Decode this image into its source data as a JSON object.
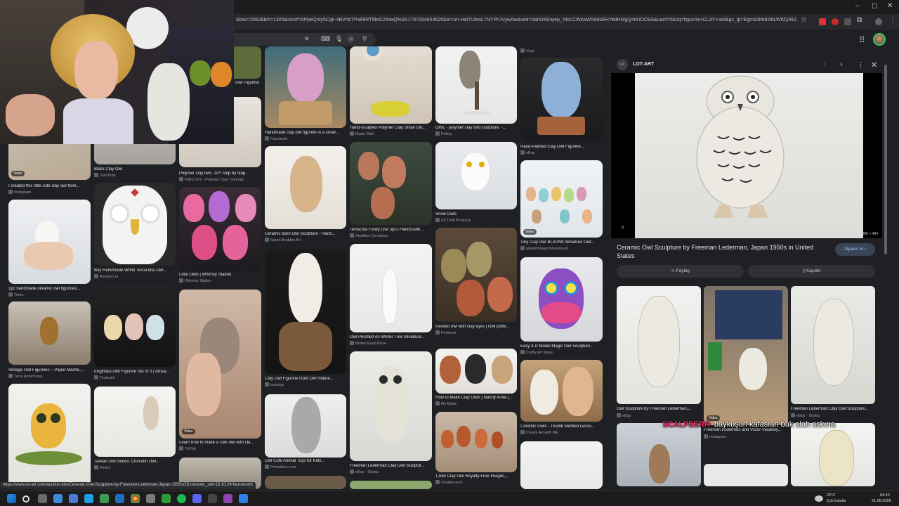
{
  "browser": {
    "url": "&biw=2560&bih=1305&ssrsf=APpeQnty5Cgk-4BVhbTPa69RTMeG294aQ%3A1787264954626&ei=un-Hat7UbmL7NYPh7vywAw&ved=0ahUKEwjep_XloLCWAxWS8dsEHYedHMgQ4dUDCBA&uact=5&oq=figurine+CLAY+owl&gs_lp=Egtnd3Mtd2l6LWltZyIRZ...",
    "window_controls": [
      "–",
      "◻",
      "✕"
    ]
  },
  "grid": {
    "col1": [
      {
        "caption": "I created this little cute clay owl from...",
        "source": "Instagram",
        "badge": "Video"
      },
      {
        "caption": "1pc handmade ceramic owl figurines...",
        "source": "Temu"
      },
      {
        "caption": "Vintage Owl Figurines ~ Paper Mache,...",
        "source": "Terra Americana"
      },
      {
        "caption": "",
        "source": ""
      }
    ],
    "col2": [
      {
        "caption": "Black Clay Owl",
        "source": "Just Pots"
      },
      {
        "caption": "Buy Handmade White Terracotta Owl...",
        "source": "Amazon.in"
      },
      {
        "caption": "Englifuku Owl Figurine Set of 3 | Artisa...",
        "source": "Tsukushi"
      },
      {
        "caption": "Taiwan Owl Series: Chocolin Owl...",
        "source": "Pinkoi"
      }
    ],
    "col3": [
      {
        "caption": "Owl Figurine",
        "source": ""
      },
      {
        "caption": "Polymer clay owl - DIY step by step...",
        "source": "FIMO DIY - Polymer Clay Tutorials"
      },
      {
        "caption": "Little Owls | Whimsy Station",
        "source": "Whimsy Station"
      },
      {
        "caption": "Learn how to make a cute owl with cla...",
        "source": "TikTok",
        "badge": "Video"
      }
    ],
    "col4": [
      {
        "caption": "Handmade clay owl figurine in a small...",
        "source": "Facebook"
      },
      {
        "caption": "Ceramic Barn Owl Sculpture - Hand...",
        "source": "Sarah Brabbin Art"
      },
      {
        "caption": "Clay Owl Figurine Gold Owl Statue...",
        "source": "leasego"
      },
      {
        "caption": "Owl Cute Animal Toys for Kids...",
        "source": "Printables.com"
      }
    ],
    "col5": [
      {
        "caption": "Hand-sculpted Polymer Clay Snow Ow...",
        "source": "Made Odd"
      },
      {
        "caption": "Terracota Funky Owl 3pcs Handcrafte...",
        "source": "Amalfiee Ceramics"
      },
      {
        "caption": "Owl Perched on Winter Tree Miniature...",
        "source": "Brown Eyed Rose"
      },
      {
        "caption": "Freeman Lederman Clay Owl Sculptur...",
        "source": "eBay · Stokta"
      }
    ],
    "col6": [
      {
        "caption": "OWL - polymer clay bird sculpture. -...",
        "source": "Folksy"
      },
      {
        "caption": "Snow Owls",
        "source": "ACTIVA Products"
      },
      {
        "caption": "Painted owl with clay eyes | Owl potte...",
        "source": "Pinterest"
      },
      {
        "caption": "How to Make Clay Owls | Nanny Anita |...",
        "source": "My Baba"
      },
      {
        "caption": "1,584 Clay Owl Royalty-Free Images,...",
        "source": "Shutterstock"
      }
    ],
    "col7": [
      {
        "caption": "",
        "source": "Voyij"
      },
      {
        "caption": "Hand-Painted Clay Owl Figurine...",
        "source": "eBay"
      },
      {
        "caption": "Tiny Clay Owl BLAPNK Miniature Owl...",
        "source": "akademiawychowania.pl",
        "badge": "Video"
      },
      {
        "caption": "Easy 3-D Model Magic Owl Sculpture...",
        "source": "Crafty Art Ideas"
      },
      {
        "caption": "Ceramic Owls - Thumb Method Lesso...",
        "source": "Create Art with ME"
      }
    ]
  },
  "panel": {
    "source_logo": "LA",
    "source_name": "LOT-ART",
    "image_size": "880 × 484",
    "title": "Ceramic Owl Sculpture by Freeman Lederman, Japan 1950s in United States",
    "visit_label": "Ziyaret et",
    "share_label": "Paylaş",
    "save_label": "Kaydet",
    "related": [
      {
        "caption": "Owl Sculpture by Freeman Lederman,...",
        "source": "eBay"
      },
      {
        "caption": "Freeman Lederman and Victor Vasarely...",
        "source": "Instagram",
        "badge": "Video"
      },
      {
        "caption": "Freeman Lederman Clay Owl Sculpture...",
        "source": "eBay · Stokta"
      }
    ]
  },
  "overlay": {
    "nick": "SCALPEERR",
    "message": "baykuşun kafasıan bak alah askına"
  },
  "status_url": "https://www.lot-art.com/auction-lots/Ceramic-Owl-Sculpture-by-Freeman-Lederman-Japan-1950s/25-ceramic_owl-13.10.24-farnsworth",
  "taskbar": {
    "weather_temp": "22°C",
    "weather_text": "Çok bulutlu",
    "time": "03:42",
    "date": "21.08.2026"
  }
}
